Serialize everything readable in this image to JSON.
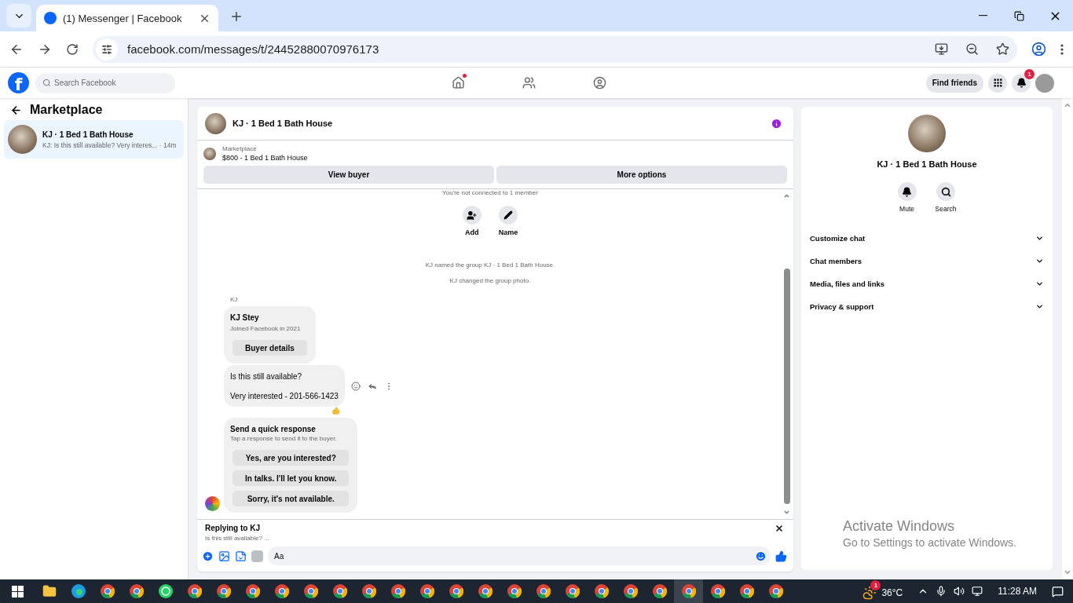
{
  "browser": {
    "tab_title": "(1) Messenger | Facebook",
    "url": "facebook.com/messages/t/24452880070976173"
  },
  "topbar": {
    "logo_letter": "f",
    "search_placeholder": "Search Facebook",
    "nav": [
      {
        "kind": "home",
        "badge": true
      },
      {
        "kind": "friends",
        "badge": false
      },
      {
        "kind": "groups",
        "badge": false
      }
    ],
    "find_friends": "Find friends",
    "notification_count": "1"
  },
  "sidebar": {
    "title": "Marketplace",
    "chats": [
      {
        "name": "KJ · 1 Bed 1 Bath House",
        "preview": "KJ: Is this still available? Very interes... · 14m",
        "selected": true
      }
    ]
  },
  "chat": {
    "title": "KJ · 1 Bed 1 Bath House",
    "listing": {
      "label": "Marketplace",
      "text": "$800 - 1 Bed 1 Bath House"
    },
    "buttons": [
      "View buyer",
      "More options"
    ],
    "notice": "You're not connected to 1 member",
    "actions": [
      {
        "kind": "add",
        "label": "Add"
      },
      {
        "kind": "name",
        "label": "Name"
      }
    ],
    "events": [
      "KJ named the group KJ · 1 Bed 1 Bath House.",
      "KJ changed the group photo."
    ],
    "sender": "KJ",
    "buyer": {
      "name": "KJ Stey",
      "joined": "Joined Facebook in 2021",
      "button": "Buyer details"
    },
    "message": {
      "lines": [
        "Is this still available?",
        "Very interested - 201-566-1423"
      ]
    },
    "quick": {
      "title": "Send a quick response",
      "hint": "Tap a response to send it to the buyer.",
      "options": [
        "Yes, are you interested?",
        "In talks. I'll let you know.",
        "Sorry, it's not available."
      ]
    },
    "reply": {
      "title": "Replying to KJ",
      "preview": "Is this still available? ..."
    },
    "composer": {
      "placeholder": "Aa"
    }
  },
  "details": {
    "title": "KJ · 1 Bed 1 Bath House",
    "actions": [
      {
        "kind": "mute",
        "label": "Mute"
      },
      {
        "kind": "search",
        "label": "Search"
      }
    ],
    "sections": [
      {
        "label": "Customize chat",
        "expanded": false
      },
      {
        "label": "Chat members",
        "expanded": false
      },
      {
        "label": "Media, files and links",
        "expanded": false
      },
      {
        "label": "Privacy & support",
        "expanded": false
      }
    ]
  },
  "activation_notice": {
    "title": "Activate Windows",
    "text": "Go to Settings to activate Windows."
  },
  "taskbar": {
    "apps": [
      {
        "kind": "explorer",
        "selected": false
      },
      {
        "kind": "edge",
        "selected": false
      },
      {
        "kind": "chrome",
        "selected": false
      },
      {
        "kind": "chrome",
        "selected": false
      },
      {
        "kind": "whatsapp",
        "selected": false
      },
      {
        "kind": "chrome",
        "selected": false
      },
      {
        "kind": "chrome",
        "selected": false
      },
      {
        "kind": "chrome",
        "selected": false
      },
      {
        "kind": "chrome",
        "selected": false
      },
      {
        "kind": "chrome",
        "selected": false
      },
      {
        "kind": "chrome",
        "selected": false
      },
      {
        "kind": "chrome",
        "selected": false
      },
      {
        "kind": "chrome",
        "selected": false
      },
      {
        "kind": "chrome",
        "selected": false
      },
      {
        "kind": "chrome",
        "selected": false
      },
      {
        "kind": "chrome",
        "selected": false
      },
      {
        "kind": "chrome",
        "selected": false
      },
      {
        "kind": "chrome",
        "selected": false
      },
      {
        "kind": "chrome",
        "selected": false
      },
      {
        "kind": "chrome",
        "selected": false
      },
      {
        "kind": "chrome",
        "selected": false
      },
      {
        "kind": "chrome",
        "selected": false
      },
      {
        "kind": "chrome",
        "selected": true
      },
      {
        "kind": "chrome",
        "selected": false
      },
      {
        "kind": "chrome",
        "selected": false
      },
      {
        "kind": "chrome",
        "selected": false
      }
    ],
    "weather_badge": "1",
    "temperature": "36°C",
    "time": "11:28 AM"
  }
}
